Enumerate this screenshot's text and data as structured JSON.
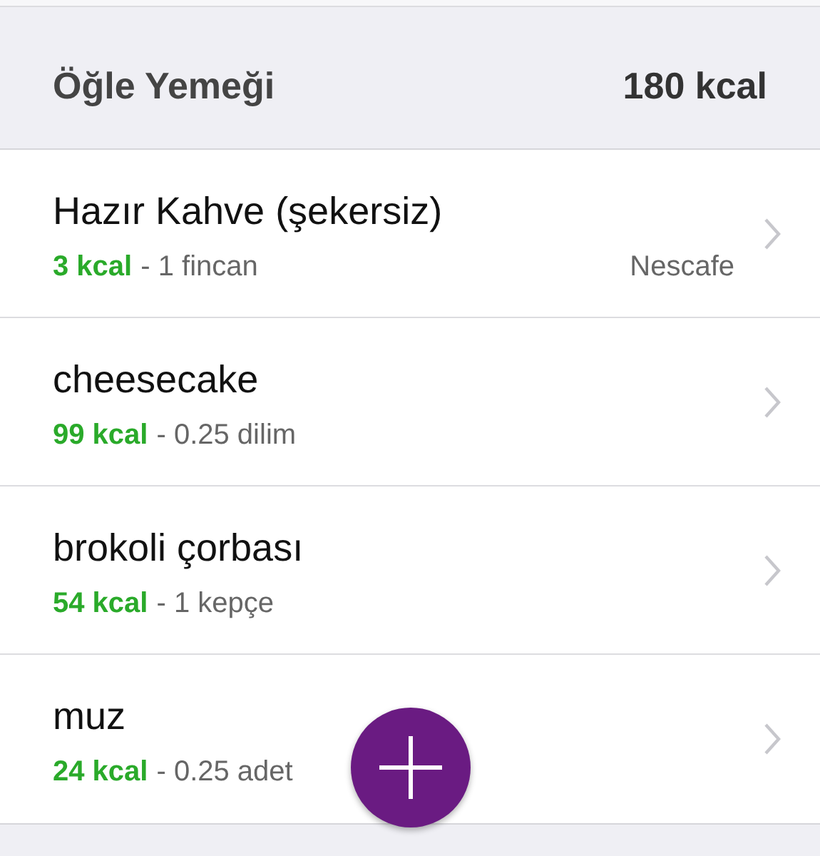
{
  "section": {
    "title": "Öğle Yemeği",
    "total": "180 kcal"
  },
  "items": [
    {
      "name": "Hazır Kahve (şekersiz)",
      "kcal": "3 kcal",
      "amount": "- 1 fincan",
      "brand": "Nescafe"
    },
    {
      "name": "cheesecake",
      "kcal": "99 kcal",
      "amount": "- 0.25 dilim"
    },
    {
      "name": "brokoli çorbası",
      "kcal": "54 kcal",
      "amount": "- 1 kepçe"
    },
    {
      "name": "muz",
      "kcal": "24 kcal",
      "amount": "- 0.25 adet"
    }
  ]
}
